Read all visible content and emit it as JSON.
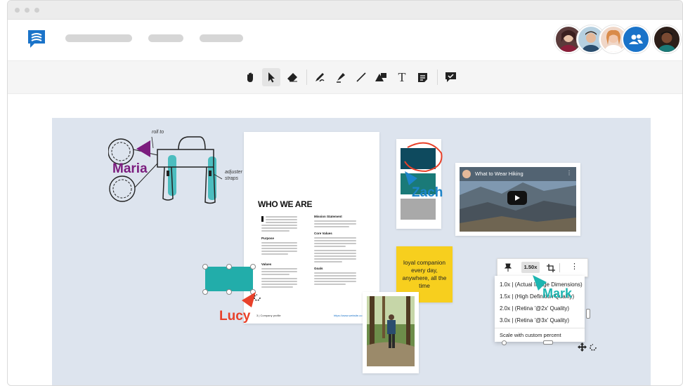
{
  "toolbar": {
    "tools": [
      "hand-icon",
      "pointer-icon",
      "eraser-icon",
      "pen-icon",
      "highlighter-icon",
      "line-icon",
      "shapes-icon",
      "text-icon",
      "sticky-note-icon",
      "comment-icon"
    ]
  },
  "board": {
    "cursors": {
      "maria": {
        "name": "Maria",
        "color": "#7b1c7e"
      },
      "zach": {
        "name": "Zach",
        "color": "#1d84c9"
      },
      "lucy": {
        "name": "Lucy",
        "color": "#e8412a"
      },
      "mark": {
        "name": "Mark",
        "color": "#1cb5b0"
      }
    },
    "sketch": {
      "label_top": "roll to",
      "label_right": "adjuster straps"
    },
    "document": {
      "title": "WHO WE ARE",
      "col1_headings": [
        "Purpose",
        "Values"
      ],
      "col2_headings": [
        "Mission Statement",
        "Core Values",
        "Goals"
      ],
      "footer_left": "3 | Company profile",
      "footer_right": "https://www.website.co"
    },
    "sticky_note": {
      "text": "loyal companion every day, anywhere, all the time",
      "color": "#f7cf1e"
    },
    "video": {
      "title": "What to Wear Hiking"
    },
    "palette": {
      "swatches": [
        "#0e4a5e",
        "#1a7a78",
        "#a9a9a9"
      ]
    },
    "scale_menu": {
      "current": "1.50x",
      "options": [
        "1.0x | (Actual Image Dimensions)",
        "1.5x | (High Definition Quality)",
        "2.0x | (Retina '@2x' Quality)",
        "3.0x | (Retina '@3x' Quality)"
      ],
      "custom": "Scale with custom percent"
    }
  },
  "colors": {
    "accent": "#1a73c9",
    "teal": "#28b3b3"
  }
}
